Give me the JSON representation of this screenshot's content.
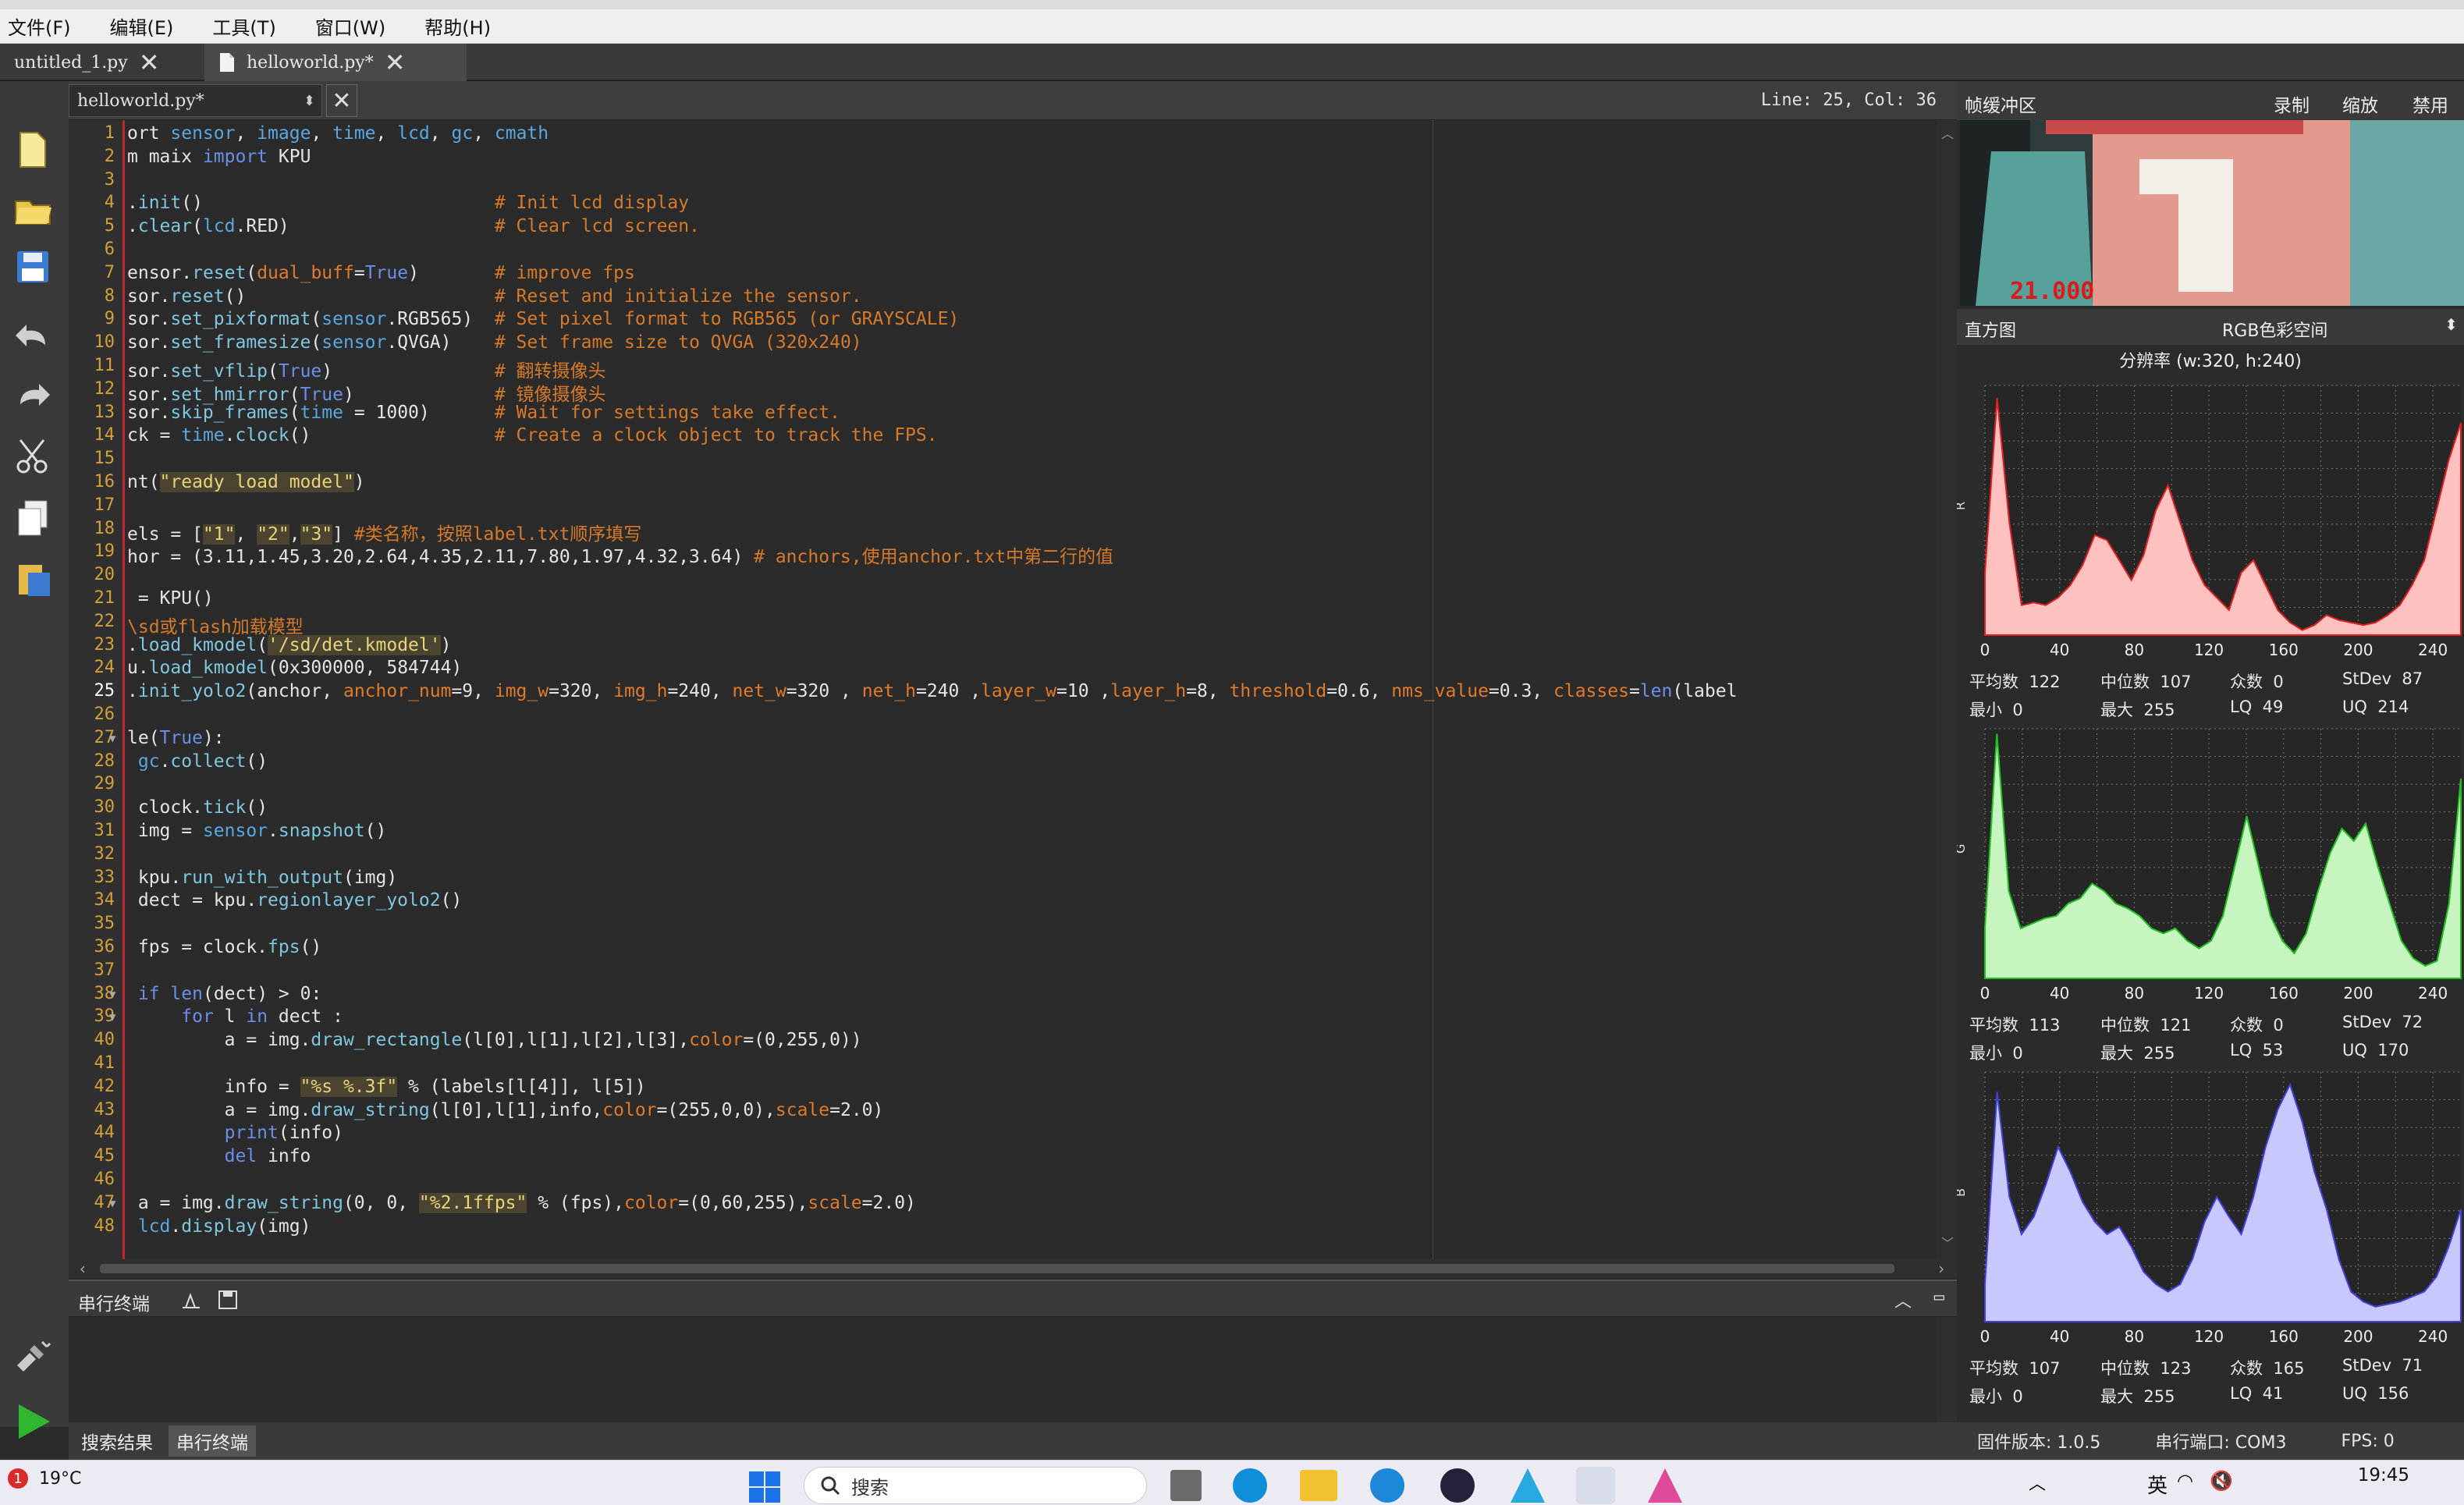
{
  "menu": [
    "文件(F)",
    "编辑(E)",
    "工具(T)",
    "窗口(W)",
    "帮助(H)"
  ],
  "file_tabs": [
    {
      "label": "untitled_1.py"
    },
    {
      "label": "helloworld.py*"
    }
  ],
  "editor": {
    "file_combo": "helloworld.py*",
    "line_col": "Line: 25, Col: 36",
    "current_line": 25,
    "lines": [
      "ort sensor, image, time, lcd, gc, cmath",
      "m maix import KPU",
      "",
      ".init()                           # Init lcd display",
      ".clear(lcd.RED)                   # Clear lcd screen.",
      "",
      "ensor.reset(dual_buff=True)       # improve fps",
      "sor.reset()                       # Reset and initialize the sensor.",
      "sor.set_pixformat(sensor.RGB565)  # Set pixel format to RGB565 (or GRAYSCALE)",
      "sor.set_framesize(sensor.QVGA)    # Set frame size to QVGA (320x240)",
      "sor.set_vflip(True)               # 翻转摄像头",
      "sor.set_hmirror(True)             # 镜像摄像头",
      "sor.skip_frames(time = 1000)      # Wait for settings take effect.",
      "ck = time.clock()                 # Create a clock object to track the FPS.",
      "",
      "nt(\"ready load model\")",
      "",
      "els = [\"1\", \"2\",\"3\"] #类名称，按照label.txt顺序填写",
      "hor = (3.11,1.45,3.20,2.64,4.35,2.11,7.80,1.97,4.32,3.64) # anchors,使用anchor.txt中第二行的值",
      "",
      " = KPU()",
      "\\sd或flash加载模型",
      ".load_kmodel('/sd/det.kmodel')",
      "u.load_kmodel(0x300000, 584744)",
      ".init_yolo2(anchor, anchor_num=9, img_w=320, img_h=240, net_w=320 , net_h=240 ,layer_w=10 ,layer_h=8, threshold=0.6, nms_value=0.3, classes=len(label",
      "",
      "le(True):",
      " gc.collect()",
      "",
      " clock.tick()",
      " img = sensor.snapshot()",
      "",
      " kpu.run_with_output(img)",
      " dect = kpu.regionlayer_yolo2()",
      "",
      " fps = clock.fps()",
      "",
      " if len(dect) > 0:",
      "     for l in dect :",
      "         a = img.draw_rectangle(l[0],l[1],l[2],l[3],color=(0,255,0))",
      "",
      "         info = \"%s %.3f\" % (labels[l[4]], l[5])",
      "         a = img.draw_string(l[0],l[1],info,color=(255,0,0),scale=2.0)",
      "         print(info)",
      "         del info",
      "",
      " a = img.draw_string(0, 0, \"%2.1ffps\" % (fps),color=(0,60,255),scale=2.0)",
      " lcd.display(img)"
    ]
  },
  "terminal": {
    "title": "串行终端"
  },
  "bottom_tabs": [
    {
      "label": "搜索结果"
    },
    {
      "label": "串行终端"
    }
  ],
  "frame_buffer": {
    "title": "帧缓冲区",
    "actions": [
      "录制",
      "缩放",
      "禁用"
    ],
    "overlay_text": "21.000"
  },
  "histogram": {
    "title": "直方图",
    "colorspace": "RGB色彩空间",
    "resolution": "分辨率 (w:320, h:240)",
    "x_ticks": [
      "0",
      "40",
      "80",
      "120",
      "160",
      "200",
      "240"
    ],
    "channels": [
      {
        "label": "R",
        "color": "#ffc0c0",
        "stroke": "#e02020",
        "values": [
          0.25,
          0.95,
          0.45,
          0.12,
          0.13,
          0.12,
          0.15,
          0.2,
          0.28,
          0.4,
          0.38,
          0.3,
          0.22,
          0.32,
          0.5,
          0.6,
          0.45,
          0.3,
          0.2,
          0.15,
          0.1,
          0.25,
          0.3,
          0.2,
          0.1,
          0.05,
          0.02,
          0.04,
          0.08,
          0.06,
          0.05,
          0.04,
          0.05,
          0.08,
          0.12,
          0.2,
          0.3,
          0.5,
          0.7,
          0.85
        ],
        "stats": {
          "mean": "122",
          "median": "107",
          "mode": "0",
          "stdev": "87",
          "min": "0",
          "max": "255",
          "lq": "49",
          "uq": "214"
        }
      },
      {
        "label": "G",
        "color": "#c6f5c0",
        "stroke": "#20c020",
        "values": [
          0.2,
          0.98,
          0.35,
          0.2,
          0.22,
          0.24,
          0.25,
          0.3,
          0.32,
          0.38,
          0.35,
          0.3,
          0.28,
          0.25,
          0.2,
          0.18,
          0.2,
          0.15,
          0.12,
          0.15,
          0.25,
          0.45,
          0.65,
          0.45,
          0.25,
          0.15,
          0.1,
          0.18,
          0.35,
          0.5,
          0.6,
          0.55,
          0.62,
          0.45,
          0.3,
          0.15,
          0.08,
          0.05,
          0.07,
          0.3,
          0.8
        ],
        "stats": {
          "mean": "113",
          "median": "121",
          "mode": "0",
          "stdev": "72",
          "min": "0",
          "max": "255",
          "lq": "53",
          "uq": "170"
        }
      },
      {
        "label": "B",
        "color": "#c8c8ff",
        "stroke": "#4040e0",
        "values": [
          0.15,
          0.92,
          0.5,
          0.35,
          0.42,
          0.55,
          0.7,
          0.6,
          0.48,
          0.4,
          0.35,
          0.38,
          0.3,
          0.2,
          0.15,
          0.12,
          0.15,
          0.25,
          0.4,
          0.5,
          0.42,
          0.35,
          0.5,
          0.7,
          0.85,
          0.95,
          0.8,
          0.6,
          0.45,
          0.25,
          0.12,
          0.08,
          0.06,
          0.07,
          0.08,
          0.1,
          0.12,
          0.18,
          0.3,
          0.45
        ],
        "stats": {
          "mean": "107",
          "median": "123",
          "mode": "165",
          "stdev": "71",
          "min": "0",
          "max": "255",
          "lq": "41",
          "uq": "156"
        }
      }
    ],
    "stat_labels": {
      "mean": "平均数",
      "median": "中位数",
      "mode": "众数",
      "stdev": "StDev",
      "min": "最小",
      "max": "最大",
      "lq": "LQ",
      "uq": "UQ"
    }
  },
  "status": {
    "firmware": "固件版本: 1.0.5",
    "port": "串行端口: COM3",
    "fps": "FPS: 0"
  },
  "taskbar": {
    "weather_badge": "1",
    "temp": "19°C",
    "search_placeholder": "搜索",
    "ime": "英",
    "time": "19:45"
  }
}
